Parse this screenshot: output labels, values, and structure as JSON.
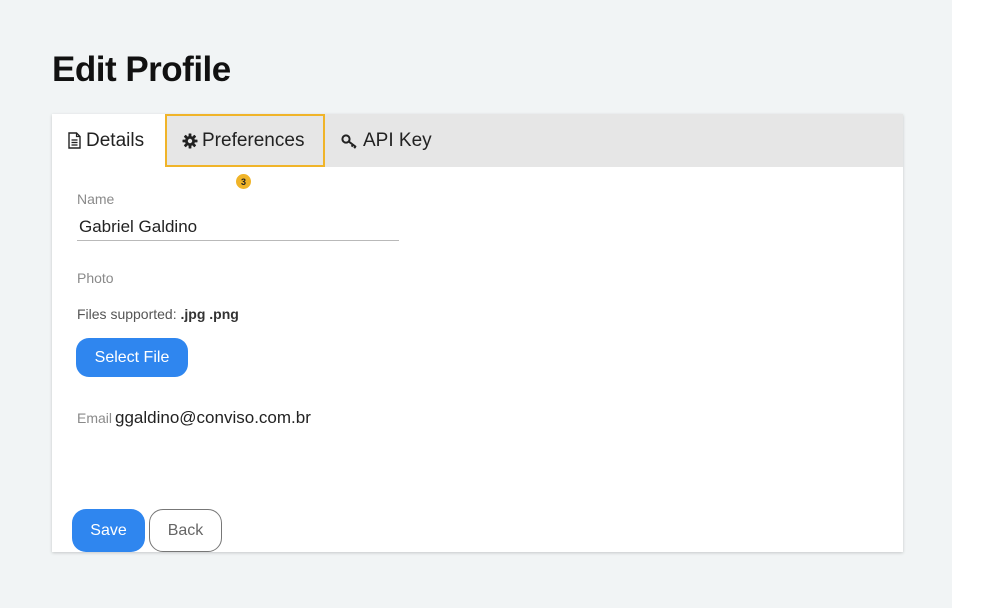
{
  "page": {
    "title": "Edit Profile"
  },
  "tabs": {
    "details": {
      "label": "Details",
      "icon": "file-text-icon"
    },
    "preferences": {
      "label": "Preferences",
      "icon": "gear-icon",
      "badge": "3"
    },
    "api_key": {
      "label": "API Key",
      "icon": "key-icon"
    }
  },
  "form": {
    "name_label": "Name",
    "name_value": "Gabriel Galdino",
    "photo_label": "Photo",
    "files_supported_label": "Files supported:",
    "files_supported_types": ".jpg .png",
    "select_file_label": "Select File",
    "email_label": "Email",
    "email_value": "ggaldino@conviso.com.br"
  },
  "actions": {
    "save_label": "Save",
    "back_label": "Back"
  },
  "colors": {
    "page_background": "#f1f4f5",
    "primary": "#2f86ef",
    "highlight": "#f0b429",
    "tabbar": "#e6e6e6"
  }
}
